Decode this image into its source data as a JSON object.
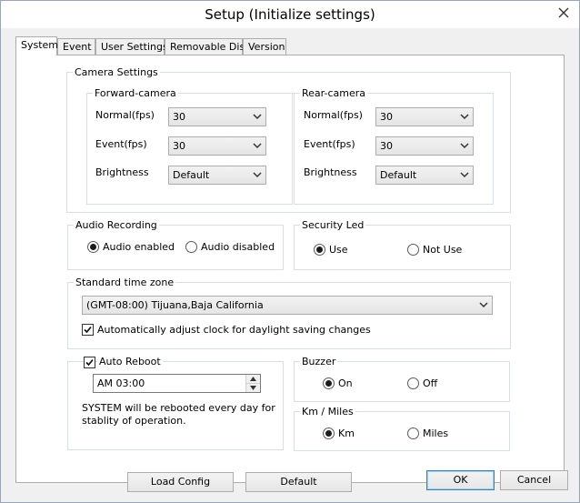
{
  "window": {
    "title": "Setup (Initialize settings)"
  },
  "tabs": [
    {
      "label": "System"
    },
    {
      "label": "Event"
    },
    {
      "label": "User Settings"
    },
    {
      "label": "Removable Disk"
    },
    {
      "label": "Version"
    }
  ],
  "camera": {
    "title": "Camera Settings",
    "forward": {
      "title": "Forward-camera",
      "normal_label": "Normal(fps)",
      "normal_value": "30",
      "event_label": "Event(fps)",
      "event_value": "30",
      "brightness_label": "Brightness",
      "brightness_value": "Default"
    },
    "rear": {
      "title": "Rear-camera",
      "normal_label": "Normal(fps)",
      "normal_value": "30",
      "event_label": "Event(fps)",
      "event_value": "30",
      "brightness_label": "Brightness",
      "brightness_value": "Default"
    }
  },
  "audio": {
    "title": "Audio Recording",
    "enabled_label": "Audio enabled",
    "disabled_label": "Audio disabled",
    "selected": "enabled"
  },
  "security_led": {
    "title": "Security Led",
    "use_label": "Use",
    "not_use_label": "Not Use",
    "selected": "use"
  },
  "timezone": {
    "title": "Standard time zone",
    "value": "(GMT-08:00) Tijuana,Baja California",
    "dst_label": "Automatically adjust clock for daylight saving changes",
    "dst_checked": true
  },
  "reboot": {
    "label": "Auto Reboot",
    "checked": true,
    "time_value": "AM  03:00",
    "note": "SYSTEM will be rebooted every day for stablity of operation."
  },
  "buzzer": {
    "title": "Buzzer",
    "on_label": "On",
    "off_label": "Off",
    "selected": "on"
  },
  "units": {
    "title": "Km / Miles",
    "km_label": "Km",
    "miles_label": "Miles",
    "selected": "km"
  },
  "buttons": {
    "load_config": "Load Config",
    "default": "Default",
    "ok": "OK",
    "cancel": "Cancel"
  }
}
